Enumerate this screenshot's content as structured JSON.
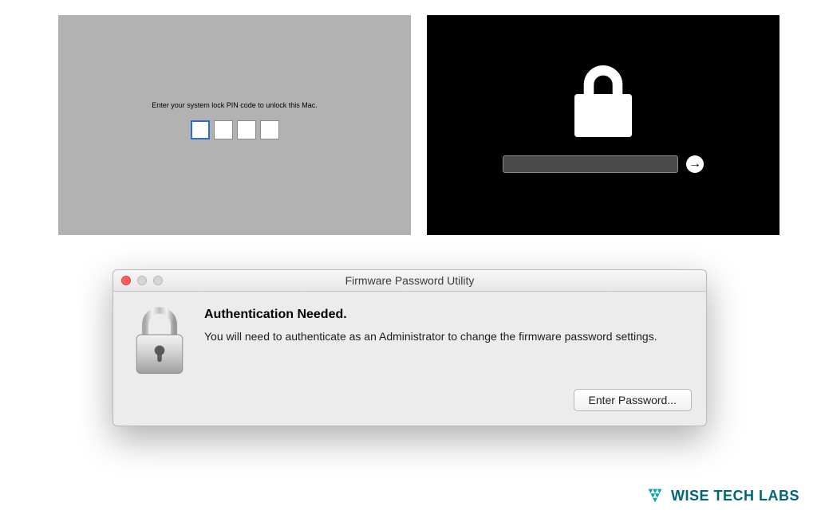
{
  "pin_screen": {
    "instruction": "Enter your system lock PIN code to unlock this Mac.",
    "digits": 4
  },
  "lock_screen": {
    "next_glyph": "→"
  },
  "dialog": {
    "title": "Firmware Password Utility",
    "heading": "Authentication Needed.",
    "description": "You will need to authenticate as an Administrator to change the firmware password settings.",
    "button_label": "Enter Password..."
  },
  "watermark": {
    "text": "WISE TECH LABS"
  },
  "colors": {
    "pin_bg": "#b2b2b2",
    "lock_bg": "#000000",
    "dialog_bg": "#ececec",
    "accent": "#2a6bd8",
    "brand": "#006579"
  }
}
